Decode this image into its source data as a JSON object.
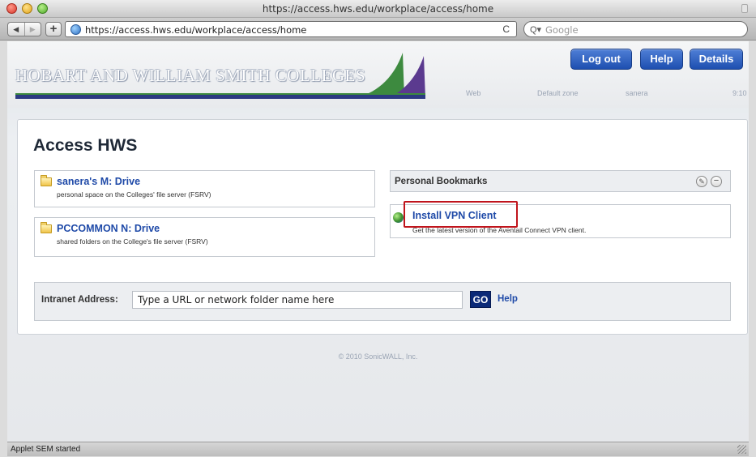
{
  "window": {
    "title": "https://access.hws.edu/workplace/access/home"
  },
  "toolbar": {
    "back_glyph": "◀",
    "forward_glyph": "▶",
    "add_glyph": "+",
    "url": "https://access.hws.edu/workplace/access/home",
    "reload_glyph": "C",
    "search_glyph": "Q▾",
    "search_placeholder": "Google"
  },
  "header": {
    "college_name": "HOBART AND WILLIAM SMITH COLLEGES",
    "logout_label": "Log out",
    "help_label": "Help",
    "details_label": "Details",
    "status": {
      "web": "Web",
      "zone": "Default zone",
      "user": "sanera",
      "time": "9:10"
    },
    "colors": {
      "green": "#3d8a3f",
      "purple": "#5b3a8f",
      "navy": "#2c3a82"
    }
  },
  "main": {
    "title": "Access HWS",
    "drives": [
      {
        "title": "sanera's M: Drive",
        "description": "personal space on the Colleges' file server (FSRV)"
      },
      {
        "title": "PCCOMMON N: Drive",
        "description": "shared folders on the College's file server (FSRV)"
      }
    ],
    "bookmarks": {
      "title": "Personal Bookmarks",
      "edit_glyph": "✎",
      "remove_glyph": "−",
      "items": [
        {
          "label": "Install VPN Client",
          "description": "Get the latest version of the Aventail Connect VPN client."
        }
      ]
    },
    "intranet": {
      "label": "Intranet Address:",
      "placeholder": "Type a URL or network folder name here",
      "go_label": "GO",
      "help_label": "Help"
    },
    "copyright": "© 2010 SonicWALL, Inc."
  },
  "statusbar": {
    "text": "Applet SEM started"
  },
  "accent": {
    "button_blue": "#2a5cc0",
    "link_blue": "#1f4aa8",
    "highlight_red": "#c0141c"
  }
}
